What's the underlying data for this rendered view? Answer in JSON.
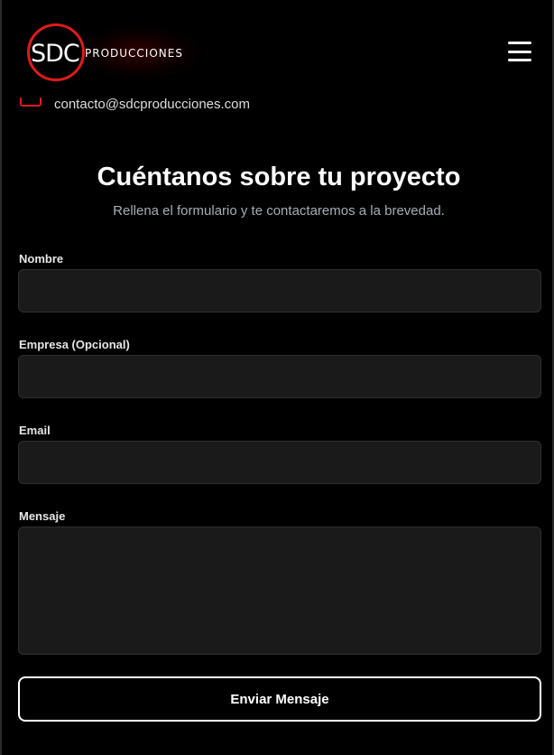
{
  "header": {
    "logo_main": "SDC",
    "logo_sub": "Producciones",
    "menu_icon": "hamburger-menu-icon"
  },
  "contact": {
    "email": "contacto@sdcproducciones.com",
    "icon": "mail-icon"
  },
  "form": {
    "title": "Cuéntanos sobre tu proyecto",
    "subtitle": "Rellena el formulario y te contactaremos a la brevedad.",
    "fields": {
      "name_label": "Nombre",
      "company_label": "Empresa (Opcional)",
      "email_label": "Email",
      "message_label": "Mensaje"
    },
    "submit_label": "Enviar Mensaje"
  },
  "colors": {
    "background": "#000000",
    "accent": "#e01a1a",
    "field_bg": "#1a1a1a",
    "subtitle": "#a7acb5"
  }
}
